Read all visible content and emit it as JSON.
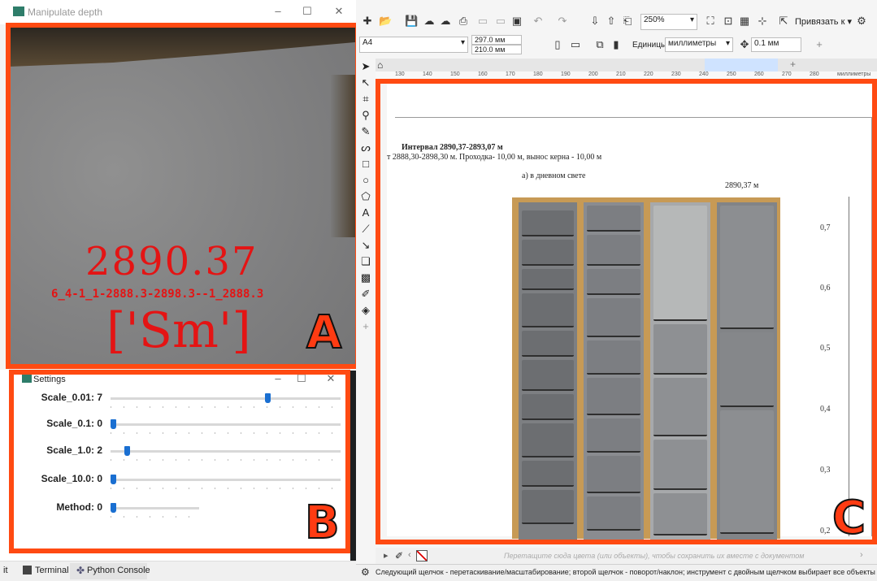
{
  "depth_window": {
    "title": "Manipulate depth",
    "depth_value": "2890.37",
    "sample_id": "6_4-1_1-2888.3-2898.3--1_2888.3",
    "lithology": "['Sm']",
    "badge": "A"
  },
  "settings_window": {
    "title": "Settings",
    "badge": "B",
    "sliders": [
      {
        "label": "Scale_0.01: 7",
        "fraction": 0.69
      },
      {
        "label": "Scale_0.1: 0",
        "fraction": 0.0
      },
      {
        "label": "Scale_1.0: 2",
        "fraction": 0.06
      },
      {
        "label": "Scale_10.0: 0",
        "fraction": 0.0
      },
      {
        "label": "Method: 0",
        "fraction": 0.0
      }
    ]
  },
  "ide": {
    "tabs": [
      "Terminal",
      "Python Console"
    ],
    "left_text": "it"
  },
  "corel": {
    "zoom": "250%",
    "snap_label": "Привязать к",
    "page_size": "A4",
    "width": "297.0 мм",
    "height": "210.0 мм",
    "units_label": "Единицы:",
    "units_value": "миллиметры",
    "nudge": "0.1 мм",
    "ruler_unit": "миллиметры",
    "ruler_ticks": [
      "130",
      "140",
      "150",
      "160",
      "170",
      "180",
      "190",
      "200",
      "210",
      "220",
      "230",
      "240",
      "250",
      "260",
      "270",
      "280"
    ],
    "badge": "C",
    "document": {
      "interval": "Интервал  2890,37-2893,07 м",
      "info": "т 2888,30-2898,30 м. Проходка- 10,00 м, вынос керна - 10,00 м",
      "caption": "а) в дневном свете",
      "top_depth": "2890,37 м",
      "scale_labels": [
        "0,7",
        "0,6",
        "0,5",
        "0,4",
        "0,3",
        "0,2"
      ]
    },
    "palette_hint": "Перетащите сюда цвета (или объекты), чтобы сохранить их вместе с документом",
    "status_text": "Следующий щелчок - перетаскивание/масштабирование; второй щелчок - поворот/наклон; инструмент с двойным щелчком выбирает все объекты; Sh"
  },
  "colors": {
    "frame_orange": "#ff4a12",
    "overlay_red": "#e41414",
    "slider_blue": "#1a6fd1"
  }
}
